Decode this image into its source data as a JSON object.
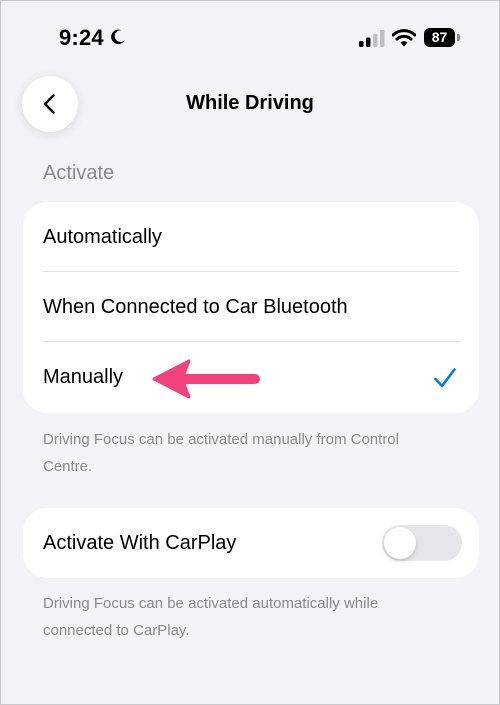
{
  "status_bar": {
    "time": "9:24",
    "battery_level": "87",
    "icons": [
      "moon-icon",
      "signal-icon",
      "wifi-icon",
      "battery-icon"
    ]
  },
  "nav": {
    "title": "While Driving",
    "back_icon": "chevron-left-icon"
  },
  "activate_section": {
    "header": "Activate",
    "options": [
      {
        "label": "Automatically",
        "selected": false
      },
      {
        "label": "When Connected to Car Bluetooth",
        "selected": false
      },
      {
        "label": "Manually",
        "selected": true
      }
    ],
    "footnote": "Driving Focus can be activated manually from Control Centre."
  },
  "carplay_section": {
    "label": "Activate With CarPlay",
    "toggle_on": false,
    "footnote": "Driving Focus can be activated automatically while connected to CarPlay."
  },
  "colors": {
    "background": "#f2f2f7",
    "accent": "#007aff",
    "annotation_arrow": "#f2427e",
    "secondary_text": "#8a8a8e"
  }
}
